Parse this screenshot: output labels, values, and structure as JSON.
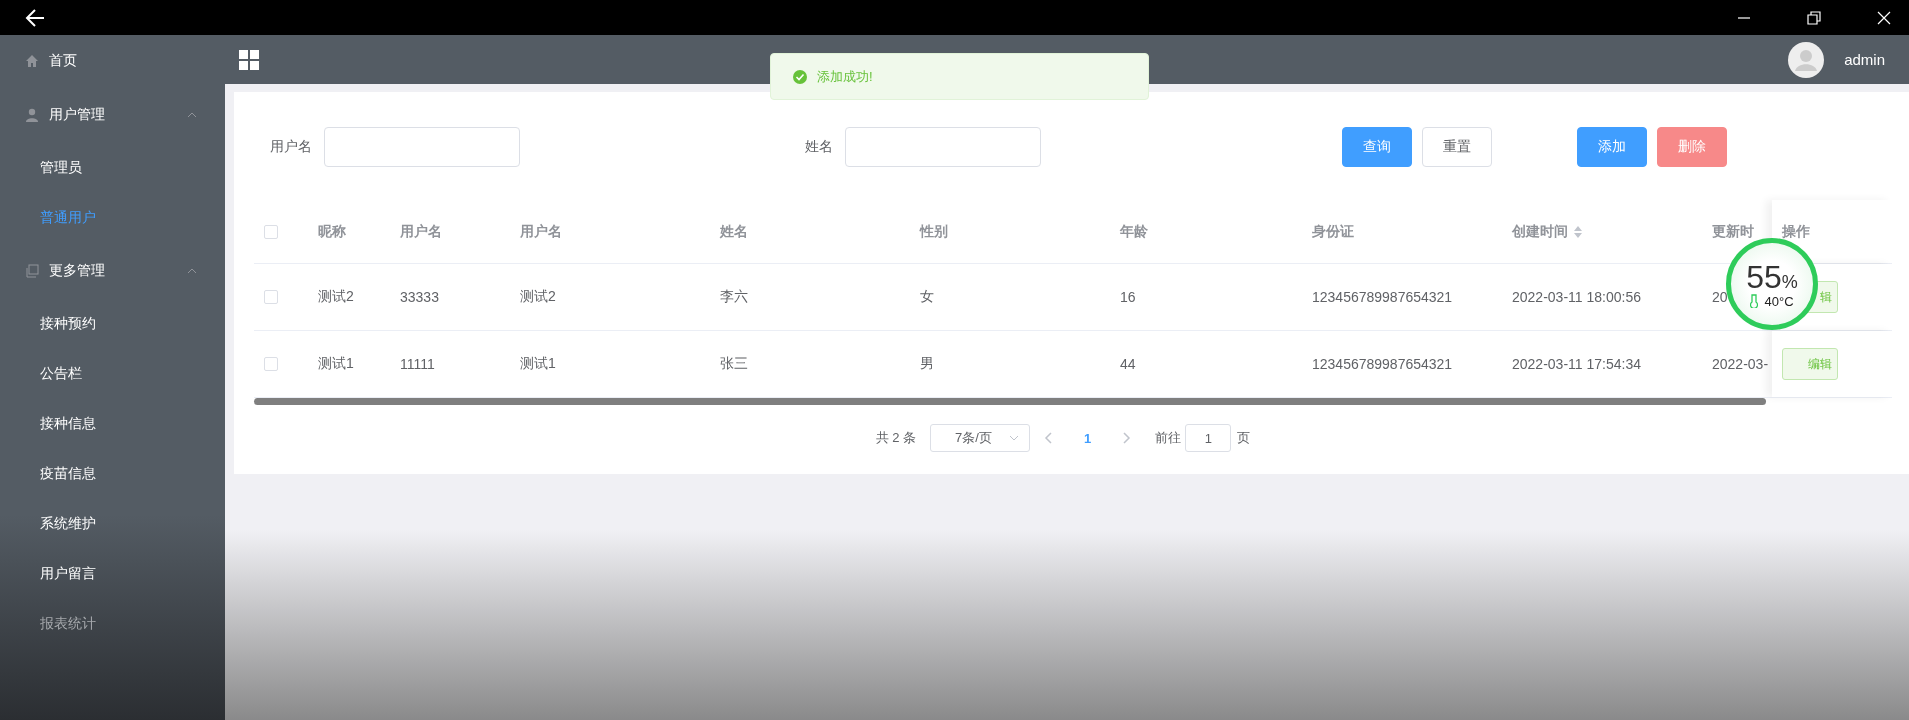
{
  "sidebar": {
    "items": [
      {
        "label": "首页",
        "selected": false
      },
      {
        "label": "用户管理",
        "expanded": true,
        "children": [
          {
            "label": "管理员",
            "selected": false
          },
          {
            "label": "普通用户",
            "selected": true
          }
        ]
      },
      {
        "label": "更多管理",
        "expanded": true,
        "children": [
          {
            "label": "接种预约",
            "selected": false
          },
          {
            "label": "公告栏",
            "selected": false
          },
          {
            "label": "接种信息",
            "selected": false
          },
          {
            "label": "疫苗信息",
            "selected": false
          },
          {
            "label": "系统维护",
            "selected": false
          },
          {
            "label": "用户留言",
            "selected": false
          },
          {
            "label": "报表统计",
            "selected": false
          }
        ]
      }
    ]
  },
  "header": {
    "user": "admin"
  },
  "toast": {
    "message": "添加成功!"
  },
  "search": {
    "fields": [
      {
        "label": "用户名"
      },
      {
        "label": "姓名"
      }
    ],
    "buttons": [
      {
        "label": "查询",
        "kind": "primary"
      },
      {
        "label": "重置",
        "kind": "plain"
      },
      {
        "label": "添加",
        "kind": "primary"
      },
      {
        "label": "删除",
        "kind": "danger"
      }
    ]
  },
  "table": {
    "header_checked": false,
    "columns": [
      {
        "label": "昵称",
        "sortable": false
      },
      {
        "label": "用户名",
        "sortable": false
      },
      {
        "label": "用户名",
        "sortable": false
      },
      {
        "label": "姓名",
        "sortable": false
      },
      {
        "label": "性别",
        "sortable": false
      },
      {
        "label": "年龄",
        "sortable": false
      },
      {
        "label": "身份证",
        "sortable": false
      },
      {
        "label": "创建时间",
        "sortable": true
      },
      {
        "label": "更新时",
        "sortable": false
      }
    ],
    "action_column": "操作",
    "rows": [
      {
        "checked": false,
        "cells": [
          "测试2",
          "33333",
          "测试2",
          "李六",
          "女",
          "16",
          "123456789987654321",
          "2022-03-11 18:00:56",
          "20"
        ],
        "action": "辑"
      },
      {
        "checked": false,
        "cells": [
          "测试1",
          "11111",
          "测试1",
          "张三",
          "男",
          "44",
          "123456789987654321",
          "2022-03-11 17:54:34",
          "2022-03-"
        ],
        "action": "编辑"
      }
    ]
  },
  "pagination": {
    "total": "共 2 条",
    "page_size": "7条/页",
    "pages": [
      {
        "label": "1",
        "selected": true
      }
    ],
    "jump_label": "前往",
    "jump_value": "1",
    "jump_suffix": "页"
  },
  "monitor": {
    "value": "55",
    "unit": "%",
    "temperature": "40°C"
  }
}
